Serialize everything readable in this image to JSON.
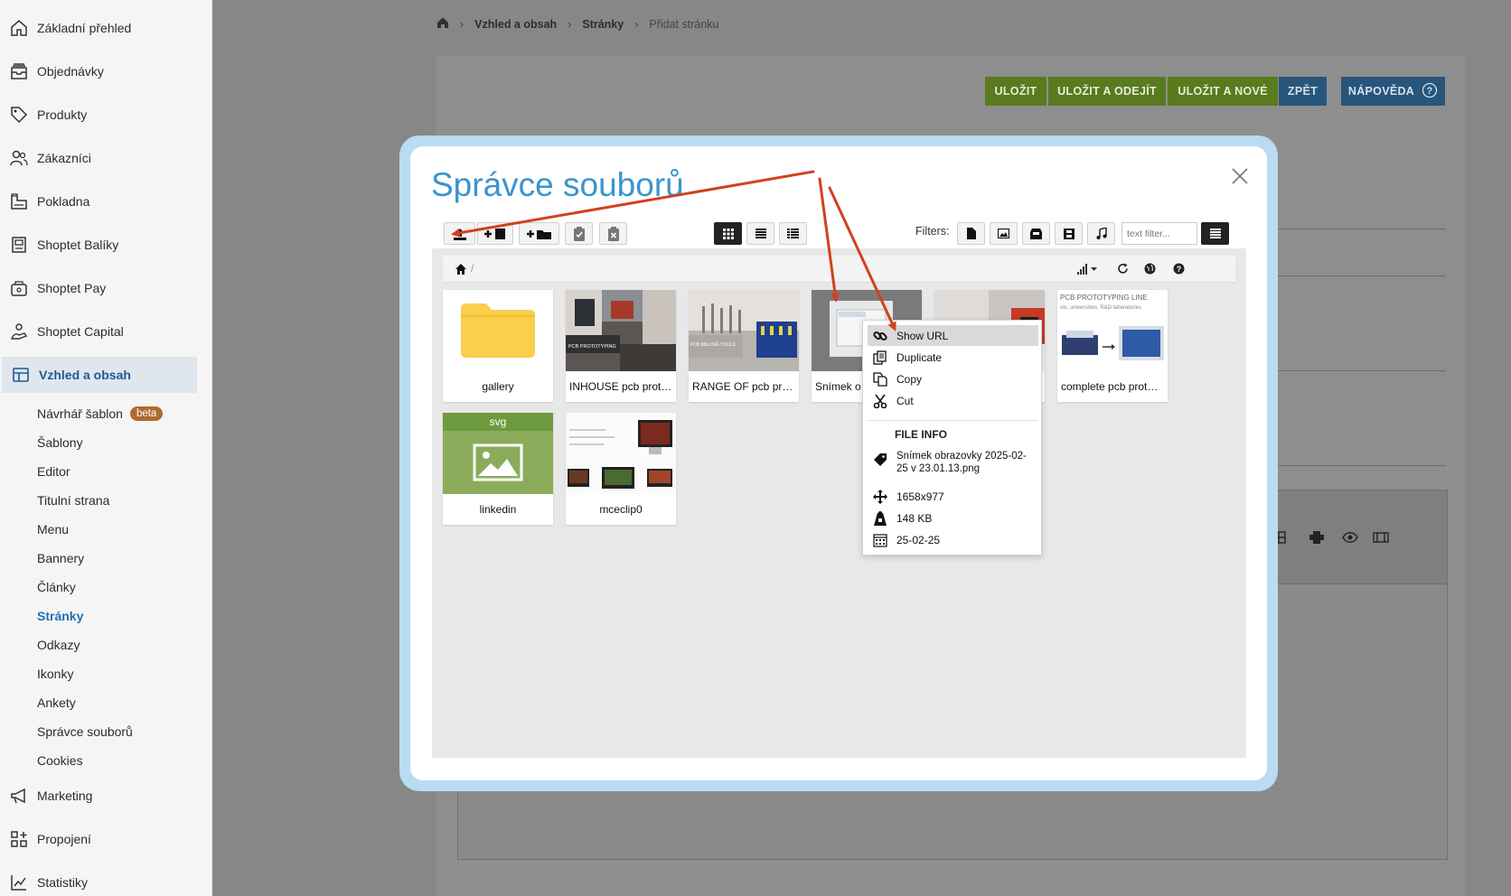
{
  "sidebar": {
    "items": [
      {
        "label": "Základní přehled",
        "icon": "home-icon"
      },
      {
        "label": "Objednávky",
        "icon": "orders-icon"
      },
      {
        "label": "Produkty",
        "icon": "tag-icon"
      },
      {
        "label": "Zákazníci",
        "icon": "users-icon"
      },
      {
        "label": "Pokladna",
        "icon": "cash-register-icon"
      },
      {
        "label": "Shoptet Balíky",
        "icon": "package-icon"
      },
      {
        "label": "Shoptet Pay",
        "icon": "payment-icon"
      },
      {
        "label": "Shoptet Capital",
        "icon": "capital-icon"
      },
      {
        "label": "Vzhled a obsah",
        "icon": "layout-icon"
      }
    ],
    "subitems": [
      "Návrhář šablon",
      "Šablony",
      "Editor",
      "Titulní strana",
      "Menu",
      "Bannery",
      "Články",
      "Stránky",
      "Odkazy",
      "Ikonky",
      "Ankety",
      "Správce souborů",
      "Cookies"
    ],
    "beta_badge": "beta",
    "bottom_items": [
      {
        "label": "Marketing",
        "icon": "megaphone-icon"
      },
      {
        "label": "Propojení",
        "icon": "integrations-icon"
      },
      {
        "label": "Statistiky",
        "icon": "stats-icon"
      }
    ]
  },
  "breadcrumb": {
    "level1": "Vzhled a obsah",
    "level2": "Stránky",
    "current": "Přidat stránku"
  },
  "actions": {
    "save": "ULOŽIT",
    "save_leave": "ULOŽIT A ODEJÍT",
    "save_new": "ULOŽIT A NOVÉ",
    "back": "ZPĚT",
    "help": "NÁPOVĚDA"
  },
  "modal": {
    "title": "Správce souborů"
  },
  "toolbar": {
    "filters_label": "Filters:",
    "text_filter_placeholder": "text filter..."
  },
  "files": [
    {
      "name": "gallery",
      "type": "folder"
    },
    {
      "name": "INHOUSE pcb prototyping",
      "type": "image",
      "overlay": "PCB PROTOTYPING"
    },
    {
      "name": "RANGE OF pcb production tools",
      "type": "image",
      "overlay": "PCB MILLING TOOLS"
    },
    {
      "name": "Snímek obrazovky 2025-02-25 v 23.01.13.png",
      "type": "image",
      "display": "Snímek o"
    },
    {
      "name": "",
      "type": "image"
    },
    {
      "name": "complete pcb prototyping line",
      "type": "image",
      "overlay": "PCB PROTOTYPING LINE",
      "overlay2": "ols, universities, R&D laboratories"
    },
    {
      "name": "linkedin",
      "type": "svg",
      "ext": "svg"
    },
    {
      "name": "mceclip0",
      "type": "image"
    }
  ],
  "context_menu": {
    "items": [
      {
        "label": "Show URL",
        "icon": "link-icon"
      },
      {
        "label": "Duplicate",
        "icon": "duplicate-icon"
      },
      {
        "label": "Copy",
        "icon": "copy-icon"
      },
      {
        "label": "Cut",
        "icon": "scissors-icon"
      }
    ],
    "file_info_header": "FILE INFO",
    "info": {
      "name": "Snímek obrazovky 2025-02-25 v 23.01.13.png",
      "name_line1": "Snímek obrazovky 2025-02-",
      "name_line2": "25 v 23.01.13.png",
      "dimensions": "1658x977",
      "size": "148 KB",
      "date": "25-02-25"
    }
  },
  "colors": {
    "accent_blue": "#3a95cf",
    "save_green": "#5a7a1e",
    "back_blue": "#27557c",
    "annotation_red": "#d2401f",
    "modal_frame": "#b9dcf2",
    "folder_yellow": "#f9cf4b",
    "svg_green": "#8aac5a"
  }
}
